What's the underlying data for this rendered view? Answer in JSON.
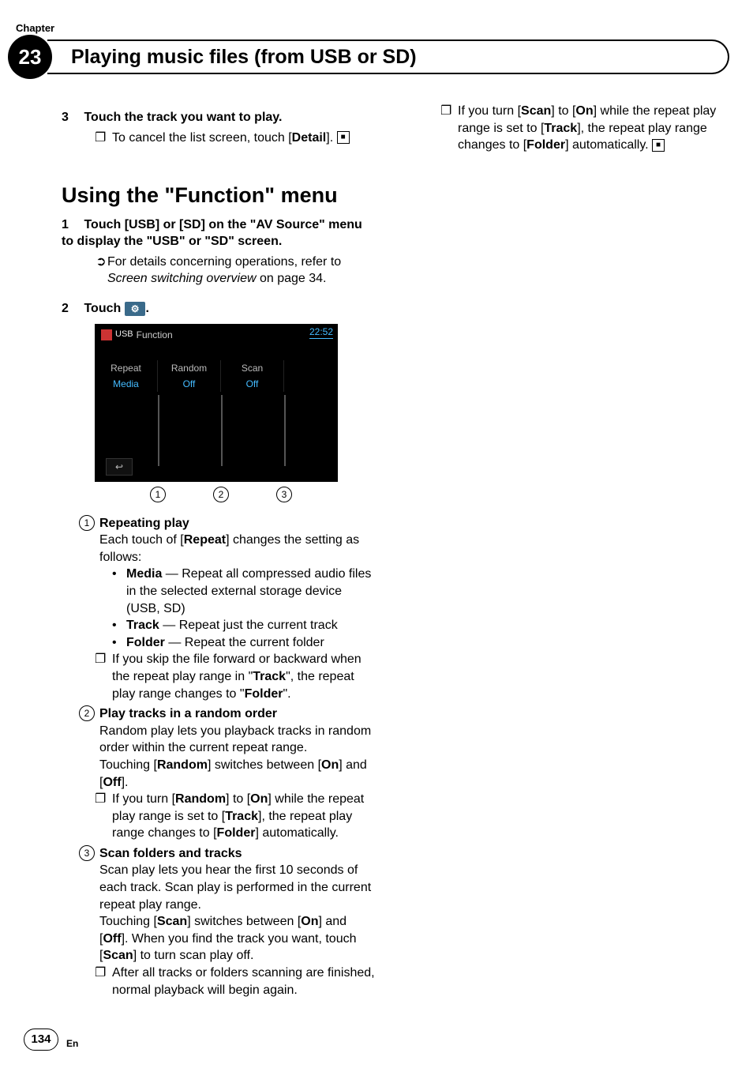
{
  "chapter_label": "Chapter",
  "chapter_number": "23",
  "page_title": "Playing music files (from USB or SD)",
  "step3": {
    "num": "3",
    "head": "Touch the track you want to play.",
    "bullet_pre": "To cancel the list screen, touch [",
    "bullet_bold": "Detail",
    "bullet_post": "]."
  },
  "h2_pre": "Using the \"",
  "h2_mono": "Function",
  "h2_post": "\" menu",
  "step1": {
    "num": "1",
    "head": "Touch [USB] or [SD] on the \"AV Source\" menu to display the \"USB\" or \"SD\" screen.",
    "bullet_pre": "For details concerning operations, refer to ",
    "bullet_em": "Screen switching overview",
    "bullet_post": " on page 34."
  },
  "step2": {
    "num": "2",
    "head_pre": "Touch ",
    "icon": "⚙",
    "head_post": "."
  },
  "screenshot": {
    "usb_label": "USB",
    "func_label": "Function",
    "time": "22:52",
    "c1a": "Repeat",
    "c2a": "Random",
    "c3a": "Scan",
    "c1b": "Media",
    "c2b": "Off",
    "c3b": "Off",
    "back": "↩",
    "call1": "1",
    "call2": "2",
    "call3": "3"
  },
  "enum1": {
    "num": "1",
    "head": "Repeating play",
    "body_pre": "Each touch of [",
    "body_b1": "Repeat",
    "body_post": "] changes the setting as follows:",
    "d1_b": "Media",
    "d1_t": " — Repeat all compressed audio files in the selected external storage device (USB, SD)",
    "d2_b": "Track",
    "d2_t": " — Repeat just the current track",
    "d3_b": "Folder",
    "d3_t": " — Repeat the current folder",
    "n1_pre": "If you skip the file forward or backward when the repeat play range in \"",
    "n1_b1": "Track",
    "n1_mid": "\", the repeat play range changes to \"",
    "n1_b2": "Folder",
    "n1_post": "\"."
  },
  "enum2": {
    "num": "2",
    "head": "Play tracks in a random order",
    "body1": "Random play lets you playback tracks in random order within the current repeat range.",
    "body2_pre": "Touching [",
    "body2_b1": "Random",
    "body2_mid": "] switches between [",
    "body2_b2": "On",
    "body2_mid2": "] and [",
    "body2_b3": "Off",
    "body2_post": "].",
    "n_pre": "If you turn [",
    "n_b1": "Random",
    "n_mid1": "] to [",
    "n_b2": "On",
    "n_mid2": "] while the repeat play range is set to [",
    "n_b3": "Track",
    "n_mid3": "], the repeat play range changes to [",
    "n_b4": "Folder",
    "n_post": "] automatically."
  },
  "enum3": {
    "num": "3",
    "head": "Scan folders and tracks",
    "body1": "Scan play lets you hear the first 10 seconds of each track. Scan play is performed in the current repeat play range.",
    "body2_pre": "Touching [",
    "body2_b1": "Scan",
    "body2_mid": "] switches between [",
    "body2_b2": "On",
    "body2_mid2": "] and [",
    "body2_b3": "Off",
    "body2_mid3": "]. When you find the track you want, touch [",
    "body2_b4": "Scan",
    "body2_post": "] to turn scan play off.",
    "n1": "After all tracks or folders scanning are finished, normal playback will begin again.",
    "n2_pre": "If you turn [",
    "n2_b1": "Scan",
    "n2_mid1": "] to [",
    "n2_b2": "On",
    "n2_mid2": "] while the repeat play range is set to [",
    "n2_b3": "Track",
    "n2_mid3": "], the repeat play range changes to [",
    "n2_b4": "Folder",
    "n2_post": "] automatically."
  },
  "page_number": "134",
  "lang": "En",
  "end_glyph": "■",
  "note_glyph": "❐",
  "ref_glyph": "➲"
}
